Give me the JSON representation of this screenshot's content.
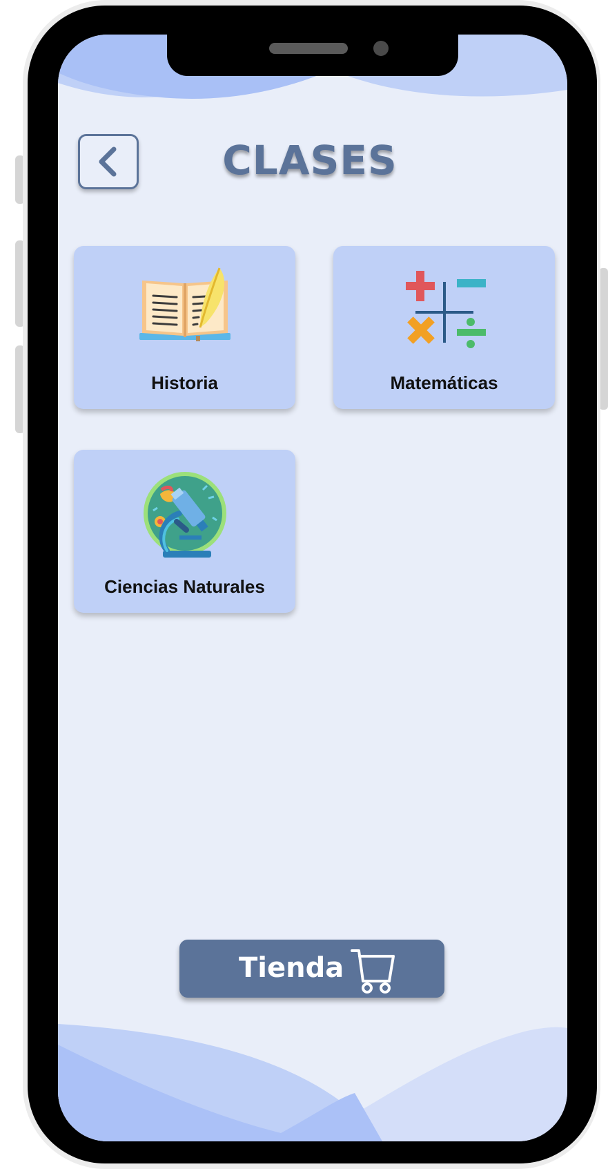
{
  "header": {
    "title": "CLASES",
    "back_icon": "chevron-left-icon"
  },
  "classes": [
    {
      "label": "Historia",
      "icon": "open-book-quill-icon"
    },
    {
      "label": "Matemáticas",
      "icon": "math-operators-icon"
    },
    {
      "label": "Ciencias Naturales",
      "icon": "microscope-icon"
    }
  ],
  "footer": {
    "shop_label": "Tienda",
    "shop_icon": "shopping-cart-icon"
  },
  "colors": {
    "accent": "#5b7399",
    "card_background": "#bfd0f7",
    "screen_background": "#e9eef9"
  }
}
